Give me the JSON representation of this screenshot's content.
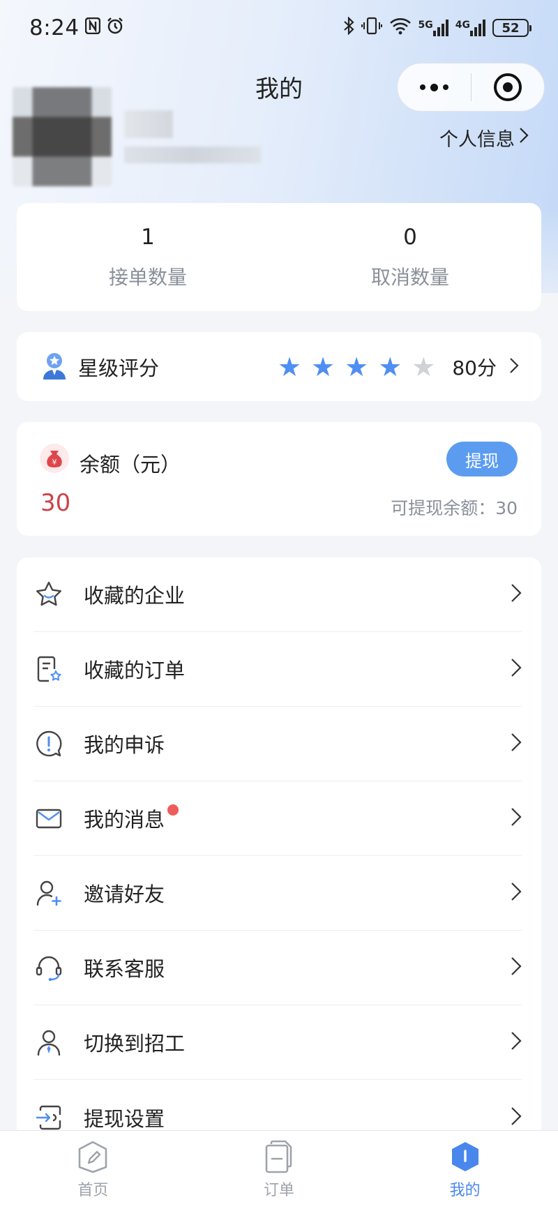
{
  "status_bar": {
    "time": "8:24",
    "network_5g": "5G",
    "network_4g": "4G",
    "battery": "52"
  },
  "nav": {
    "title": "我的"
  },
  "profile": {
    "personal_info_label": "个人信息"
  },
  "stats": [
    {
      "value": "1",
      "label": "接单数量"
    },
    {
      "value": "0",
      "label": "取消数量"
    }
  ],
  "rating": {
    "title": "星级评分",
    "stars_filled": 4,
    "stars_total": 5,
    "score": "80分"
  },
  "balance": {
    "title": "余额（元）",
    "amount": "30",
    "withdraw_label": "提现",
    "available_label": "可提现余额：30"
  },
  "menu": [
    {
      "label": "收藏的企业",
      "icon": "star-outline-icon"
    },
    {
      "label": "收藏的订单",
      "icon": "document-star-icon"
    },
    {
      "label": "我的申诉",
      "icon": "alert-bubble-icon"
    },
    {
      "label": "我的消息",
      "icon": "envelope-icon",
      "badge": "unread-dot"
    },
    {
      "label": "邀请好友",
      "icon": "person-add-icon"
    },
    {
      "label": "联系客服",
      "icon": "headset-icon"
    },
    {
      "label": "切换到招工",
      "icon": "person-switch-icon"
    },
    {
      "label": "提现设置",
      "icon": "transfer-icon"
    }
  ],
  "tabbar": {
    "active_index": 2,
    "tabs": [
      {
        "label": "首页",
        "icon": "pencil-square-icon"
      },
      {
        "label": "订单",
        "icon": "documents-icon"
      },
      {
        "label": "我的",
        "icon": "profile-tab-icon"
      }
    ]
  },
  "colors": {
    "accent_blue": "#5b9cf0",
    "star_blue": "#4f8ef2",
    "amount_red": "#c9444a",
    "badge_red": "#ef5c5c"
  }
}
